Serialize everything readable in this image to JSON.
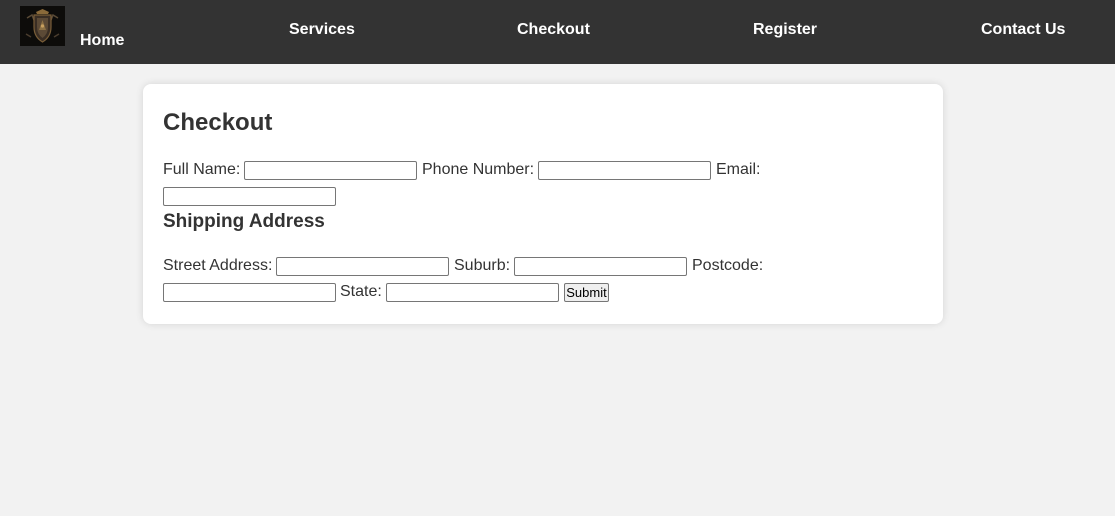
{
  "nav": {
    "home": "Home",
    "services": "Services",
    "checkout": "Checkout",
    "register": "Register",
    "contact": "Contact Us",
    "logo_icon": "crest-shield-icon"
  },
  "form": {
    "title": "Checkout",
    "full_name_label": "Full Name:",
    "phone_label": "Phone Number:",
    "email_label": "Email:",
    "shipping_title": "Shipping Address",
    "street_label": "Street Address:",
    "suburb_label": "Suburb:",
    "postcode_label": "Postcode:",
    "state_label": "State:",
    "submit_label": "Submit",
    "values": {
      "full_name": "",
      "phone": "",
      "email": "",
      "street": "",
      "suburb": "",
      "postcode": "",
      "state": ""
    }
  },
  "colors": {
    "nav_background": "#333333",
    "page_background": "#f2f2f2",
    "card_background": "#ffffff",
    "text": "#333333"
  }
}
